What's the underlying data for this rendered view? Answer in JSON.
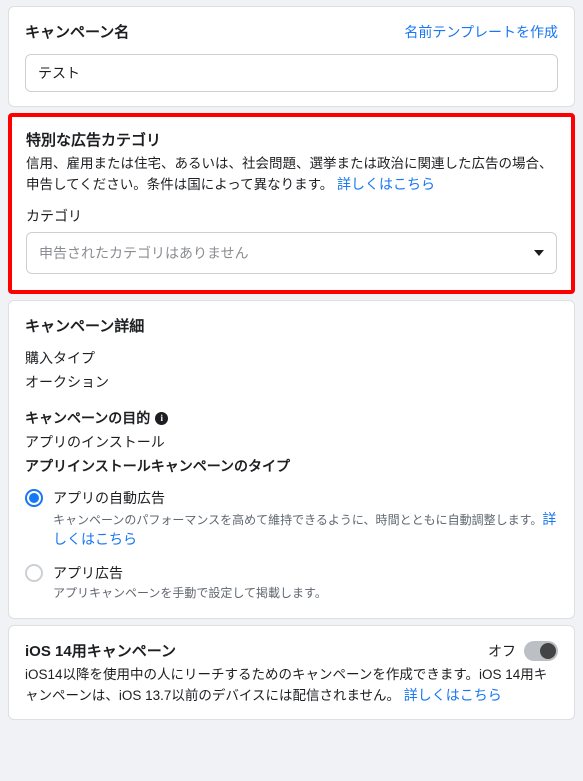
{
  "campaign_name": {
    "title": "キャンペーン名",
    "template_link": "名前テンプレートを作成",
    "value": "テスト"
  },
  "special_category": {
    "title": "特別な広告カテゴリ",
    "desc_prefix": "信用、雇用または住宅、あるいは、社会問題、選挙または政治に関連した広告の場合、申告してください。条件は国によって異なります。 ",
    "learn_more": "詳しくはこちら",
    "category_label": "カテゴリ",
    "placeholder": "申告されたカテゴリはありません"
  },
  "details": {
    "title": "キャンペーン詳細",
    "buy_type_label": "購入タイプ",
    "buy_type_value": "オークション",
    "objective_label": "キャンペーンの目的",
    "objective_value": "アプリのインストール",
    "install_type_label": "アプリインストールキャンペーンのタイプ",
    "option1": {
      "label": "アプリの自動広告",
      "help_prefix": "キャンペーンのパフォーマンスを高めて維持できるように、時間とともに自動調整します。",
      "learn_more": "詳しくはこちら"
    },
    "option2": {
      "label": "アプリ広告",
      "help": "アプリキャンペーンを手動で設定して掲載します。"
    }
  },
  "ios14": {
    "title": "iOS 14用キャンペーン",
    "desc_prefix": "iOS14以降を使用中の人にリーチするためのキャンペーンを作成できます。iOS 14用キャンペーンは、iOS 13.7以前のデバイスには配信されません。 ",
    "learn_more": "詳しくはこちら",
    "state_label": "オフ"
  }
}
